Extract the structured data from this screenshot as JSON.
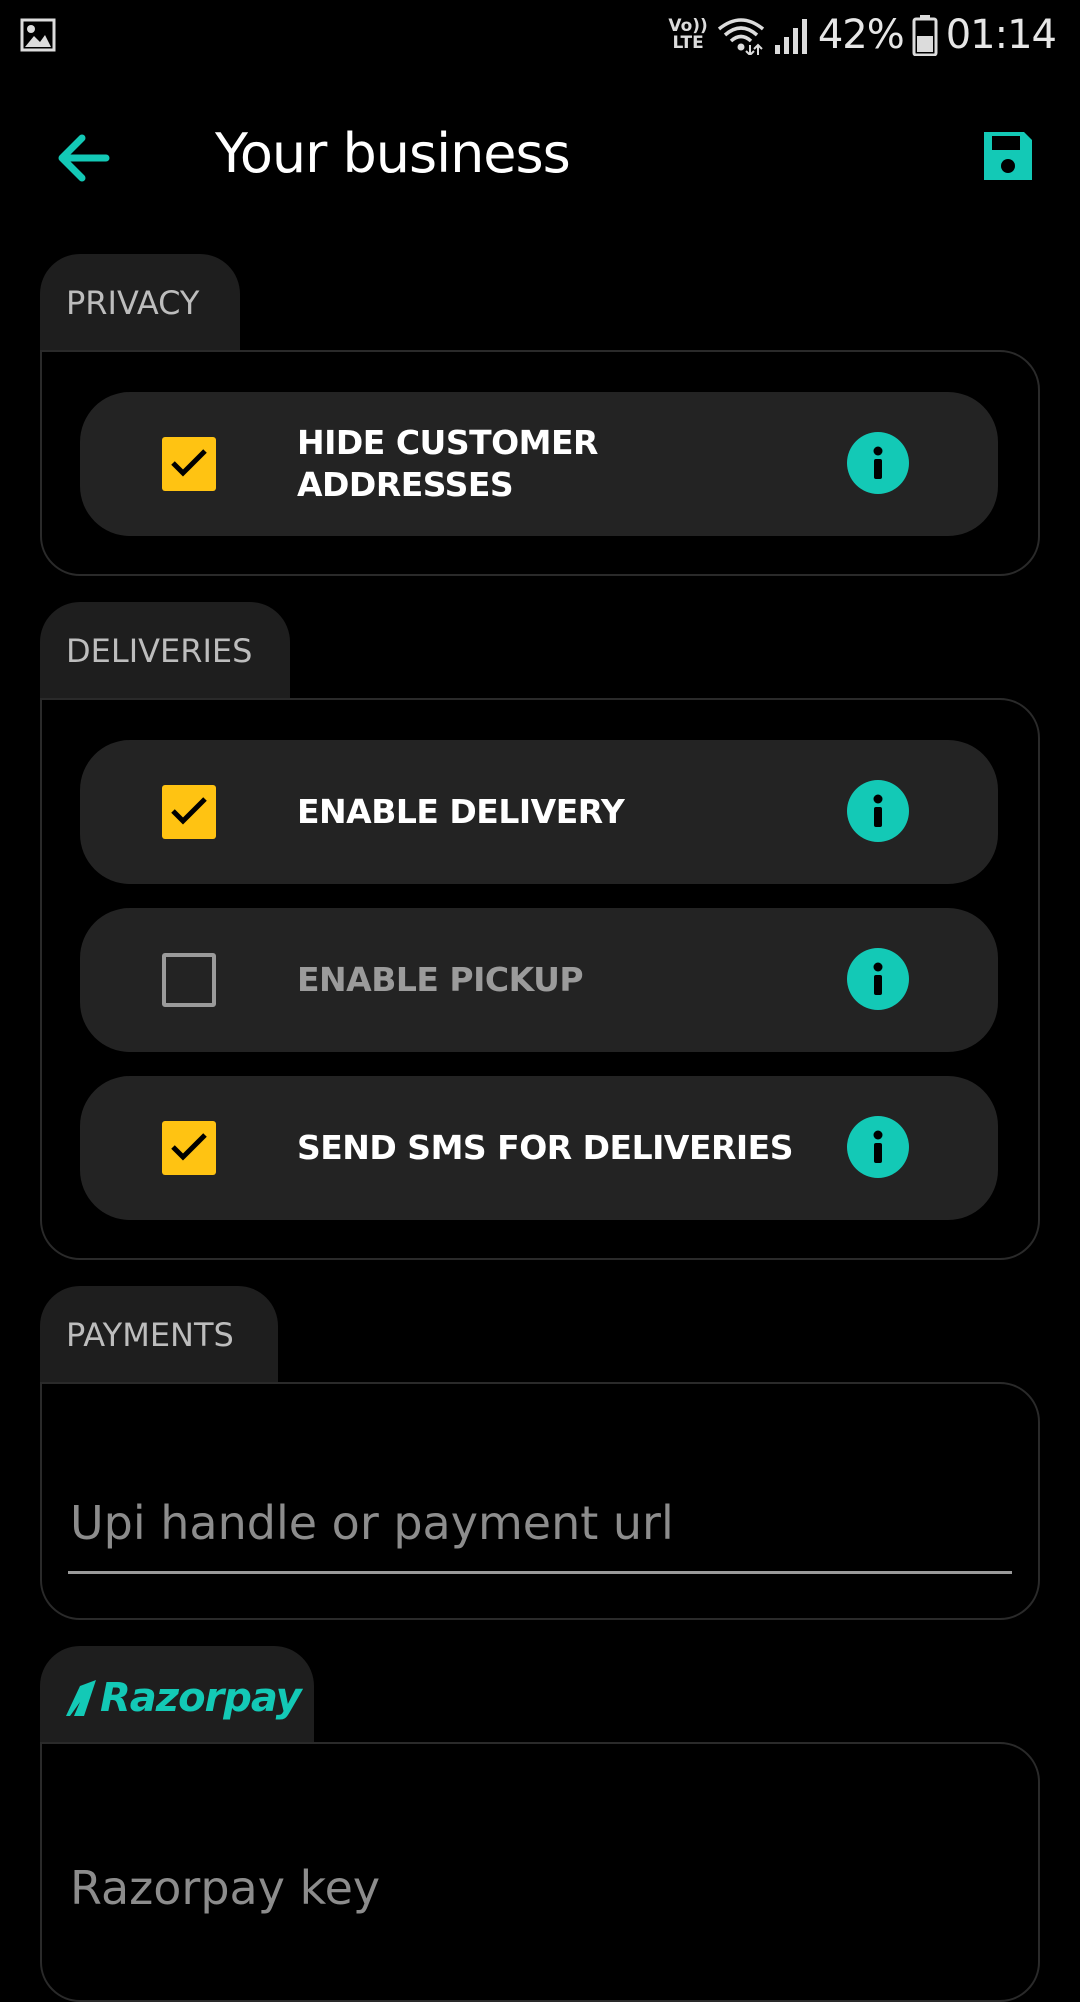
{
  "status_bar": {
    "volte_line1": "Vo))",
    "volte_line2": "LTE",
    "battery": "42%",
    "time": "01:14"
  },
  "app_bar": {
    "title": "Your business",
    "back_icon": "arrow-left-icon",
    "save_icon": "floppy-disk-icon"
  },
  "sections": {
    "privacy": {
      "title": "PRIVACY",
      "items": [
        {
          "label": "HIDE CUSTOMER ADDRESSES",
          "checked": true
        }
      ]
    },
    "deliveries": {
      "title": "DELIVERIES",
      "items": [
        {
          "label": "ENABLE DELIVERY",
          "checked": true
        },
        {
          "label": "ENABLE PICKUP",
          "checked": false
        },
        {
          "label": "SEND SMS FOR DELIVERIES",
          "checked": true
        }
      ]
    },
    "payments": {
      "title": "PAYMENTS",
      "upi_input": {
        "value": "",
        "placeholder": "Upi handle or payment url"
      }
    },
    "razorpay": {
      "logo_text": "Razorpay",
      "key_input": {
        "value": "",
        "placeholder": "Razorpay key"
      }
    }
  },
  "colors": {
    "accent": "#13c9b6",
    "checkbox_on": "#ffc312",
    "row_bg": "#232323",
    "tab_bg": "#1e1e1e",
    "background": "#000000"
  }
}
